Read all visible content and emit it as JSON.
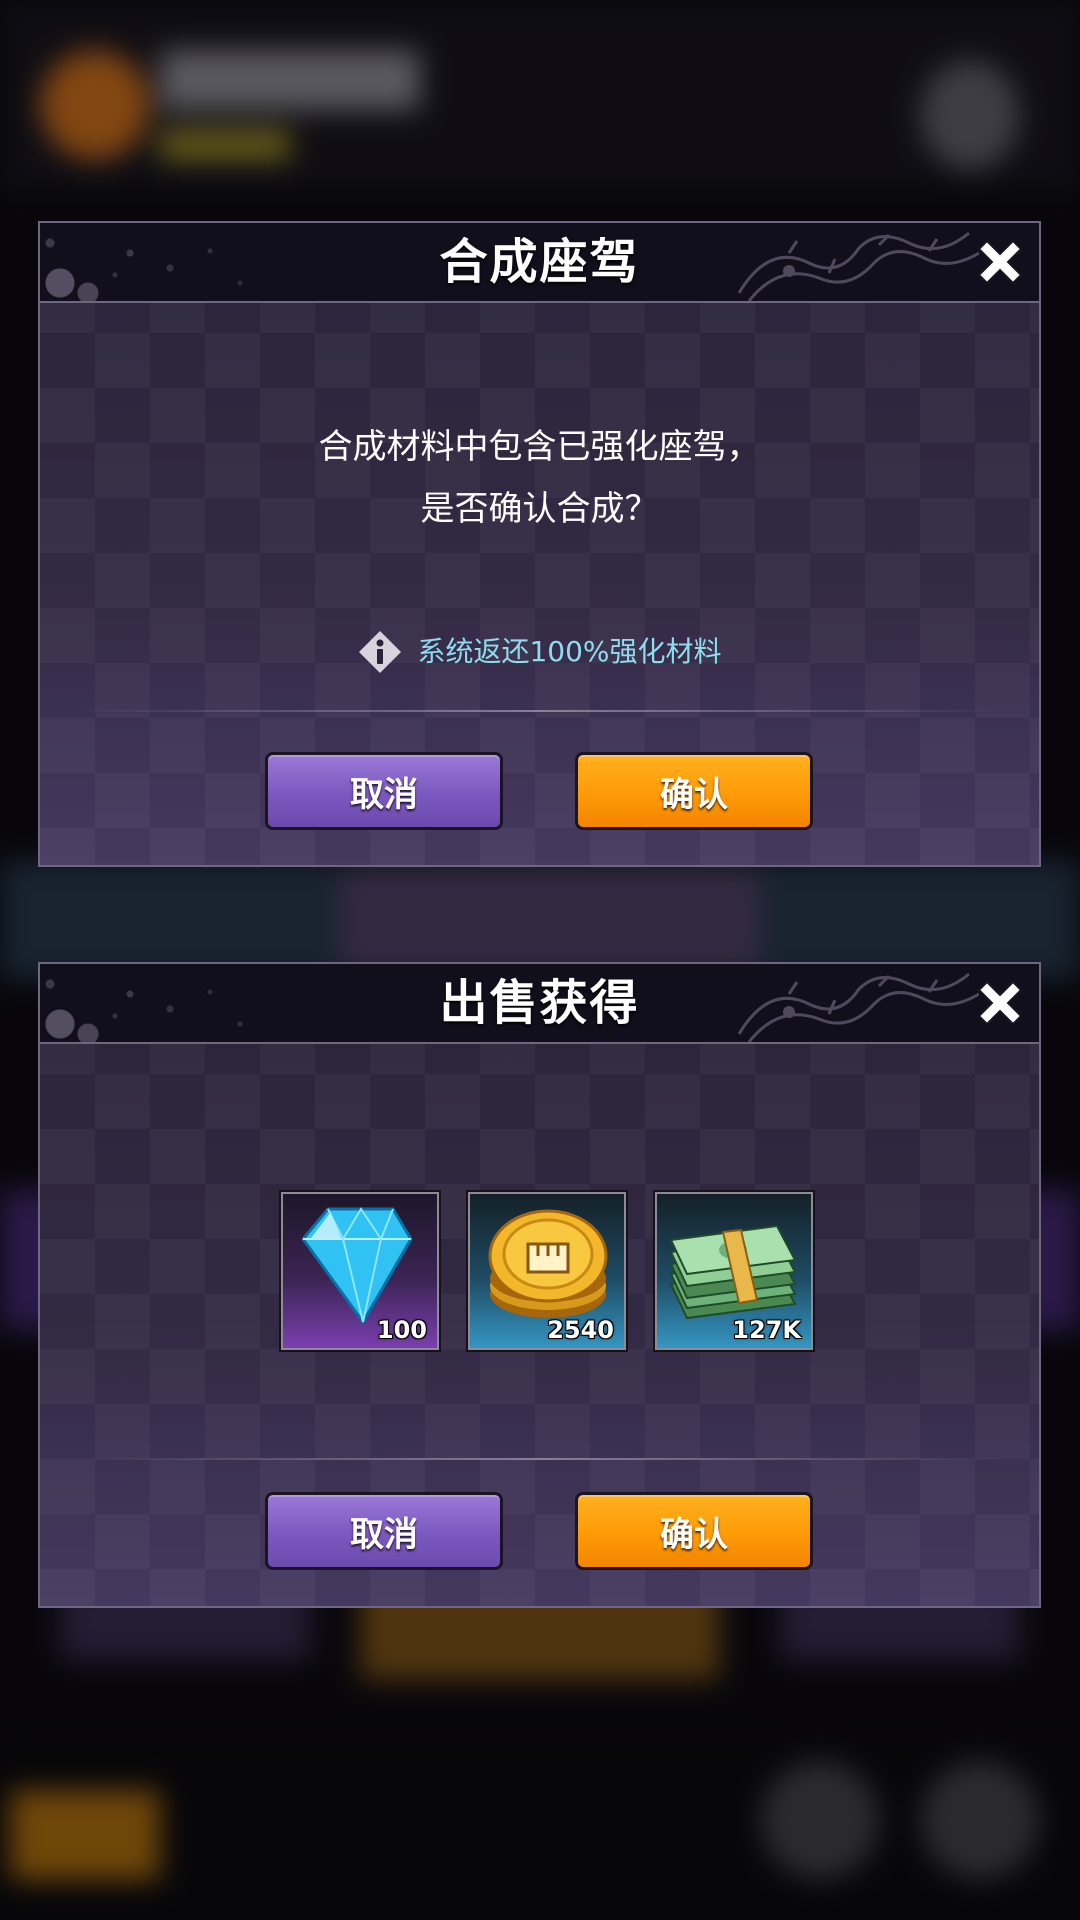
{
  "background_colors": {
    "panel_purple": "#3e2a63",
    "accent_orange": "#e98a1b",
    "accent_blue": "#3b6fa8"
  },
  "merge_dialog": {
    "title": "合成座驾",
    "close_icon": "close-x-icon",
    "message_line1": "合成材料中包含已强化座驾，",
    "message_line2": "是否确认合成？",
    "notice_icon": "info-diamond-icon",
    "notice_text": "系统返还100%强化材料",
    "cancel_label": "取消",
    "confirm_label": "确认"
  },
  "sell_dialog": {
    "title": "出售获得",
    "close_icon": "close-x-icon",
    "rewards": [
      {
        "icon": "diamond-icon",
        "quantity": "100",
        "rarity_color": "#7a3fb0"
      },
      {
        "icon": "gold-fist-coin-icon",
        "quantity": "2540",
        "rarity_color": "#3596c2"
      },
      {
        "icon": "cash-stack-icon",
        "quantity": "127K",
        "rarity_color": "#3596c2"
      }
    ],
    "cancel_label": "取消",
    "confirm_label": "确认"
  },
  "colors": {
    "cancel_button": "#7b58bf",
    "confirm_button": "#ff9a07",
    "notice_text": "#8fdcef",
    "dialog_border": "#6f6680"
  }
}
